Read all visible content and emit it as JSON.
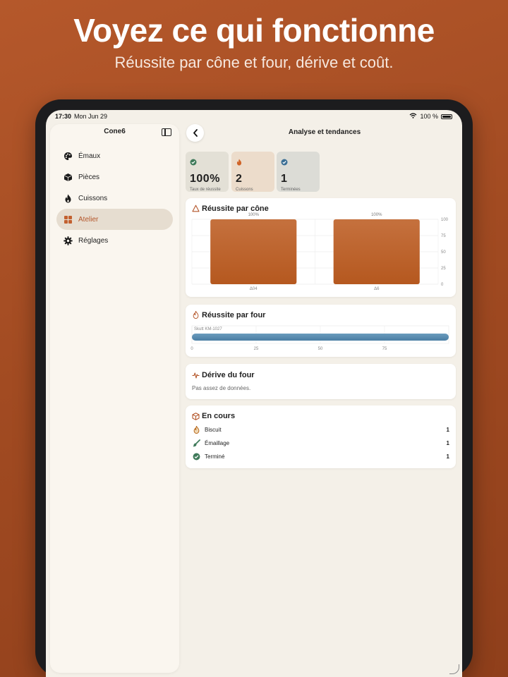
{
  "headline": "Voyez ce qui fonctionne",
  "subline": "Réussite par cône et four, dérive et coût.",
  "status": {
    "time": "17:30",
    "date": "Mon Jun 29",
    "battery": "100 %"
  },
  "sidebar": {
    "title": "Cone6",
    "items": [
      {
        "label": "Émaux",
        "icon": "palette-icon"
      },
      {
        "label": "Pièces",
        "icon": "cube-icon"
      },
      {
        "label": "Cuissons",
        "icon": "flame-icon"
      },
      {
        "label": "Atelier",
        "icon": "grid-icon",
        "active": true
      },
      {
        "label": "Réglages",
        "icon": "gear-icon"
      }
    ]
  },
  "main": {
    "title": "Analyse et tendances",
    "stats": [
      {
        "value": "100%",
        "label": "Taux de réussite",
        "icon": "checkmark-seal-icon",
        "color": "#3f7a5a"
      },
      {
        "value": "2",
        "label": "Cuissons",
        "icon": "flame-icon",
        "color": "#d06428"
      },
      {
        "value": "1",
        "label": "Terminées",
        "icon": "checkmark-seal-icon",
        "color": "#3b6f95"
      }
    ],
    "cone_card": {
      "title": "Réussite par cône"
    },
    "kiln_card": {
      "title": "Réussite par four"
    },
    "drift_card": {
      "title": "Dérive du four",
      "empty_text": "Pas assez de données."
    },
    "progress_card": {
      "title": "En cours",
      "rows": [
        {
          "label": "Biscuit",
          "count": "1",
          "icon": "flame-icon"
        },
        {
          "label": "Émaillage",
          "count": "1",
          "icon": "brush-icon"
        },
        {
          "label": "Terminé",
          "count": "1",
          "icon": "checkmark-seal-icon"
        }
      ]
    }
  },
  "chart_data": [
    {
      "type": "bar",
      "title": "Réussite par cône",
      "categories": [
        "Δ04",
        "Δ6"
      ],
      "values": [
        100,
        100
      ],
      "data_labels": [
        "100%",
        "100%"
      ],
      "ylim": [
        0,
        100
      ],
      "yticks": [
        "100",
        "75",
        "50",
        "25",
        "0"
      ],
      "bar_color": "#b5581f",
      "grid": true
    },
    {
      "type": "bar",
      "orientation": "horizontal",
      "title": "Réussite par four",
      "categories": [
        "Skutt KM-1027"
      ],
      "values": [
        100
      ],
      "xlim": [
        0,
        100
      ],
      "xticks": [
        "0",
        "25",
        "50",
        "75"
      ],
      "bar_color": "#4a7ea3",
      "grid": true
    }
  ]
}
